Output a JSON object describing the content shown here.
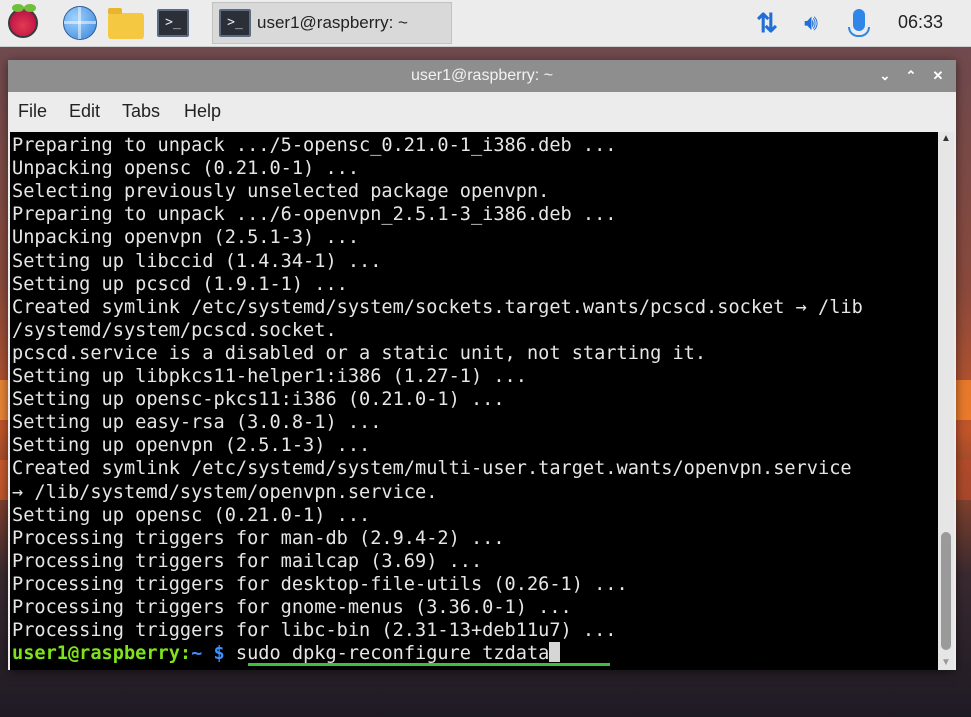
{
  "taskbar": {
    "task_title": "user1@raspberry: ~",
    "terminal_glyph": ">_",
    "clock": "06:33",
    "icons": [
      "raspberry-icon",
      "web-browser-icon",
      "file-manager-icon",
      "terminal-icon",
      "network-icon",
      "volume-icon",
      "microphone-icon"
    ]
  },
  "window": {
    "title": "user1@raspberry: ~",
    "controls": {
      "minimize": "⌄",
      "maximize": "⌃",
      "close": "✕"
    },
    "menu": [
      "File",
      "Edit",
      "Tabs",
      "Help"
    ]
  },
  "terminal": {
    "lines": [
      "Preparing to unpack .../5-opensc_0.21.0-1_i386.deb ...",
      "Unpacking opensc (0.21.0-1) ...",
      "Selecting previously unselected package openvpn.",
      "Preparing to unpack .../6-openvpn_2.5.1-3_i386.deb ...",
      "Unpacking openvpn (2.5.1-3) ...",
      "Setting up libccid (1.4.34-1) ...",
      "Setting up pcscd (1.9.1-1) ...",
      "Created symlink /etc/systemd/system/sockets.target.wants/pcscd.socket → /lib",
      "/systemd/system/pcscd.socket.",
      "pcscd.service is a disabled or a static unit, not starting it.",
      "Setting up libpkcs11-helper1:i386 (1.27-1) ...",
      "Setting up opensc-pkcs11:i386 (0.21.0-1) ...",
      "Setting up easy-rsa (3.0.8-1) ...",
      "Setting up openvpn (2.5.1-3) ...",
      "Created symlink /etc/systemd/system/multi-user.target.wants/openvpn.service",
      "→ /lib/systemd/system/openvpn.service.",
      "Setting up opensc (0.21.0-1) ...",
      "Processing triggers for man-db (2.9.4-2) ...",
      "Processing triggers for mailcap (3.69) ...",
      "Processing triggers for desktop-file-utils (0.26-1) ...",
      "Processing triggers for gnome-menus (3.36.0-1) ...",
      "Processing triggers for libc-bin (2.31-13+deb11u7) ..."
    ],
    "prompt": {
      "user_host": "user1@raspberry",
      "sep": ":",
      "path": "~",
      "symbol": " $ ",
      "command": "sudo dpkg-reconfigure tzdata"
    }
  },
  "colors": {
    "prompt_user": "#7ee21c",
    "prompt_path": "#3d8eff",
    "terminal_bg": "#000000",
    "terminal_fg": "#e6e6e6",
    "title_bar": "#8e8e8e"
  }
}
